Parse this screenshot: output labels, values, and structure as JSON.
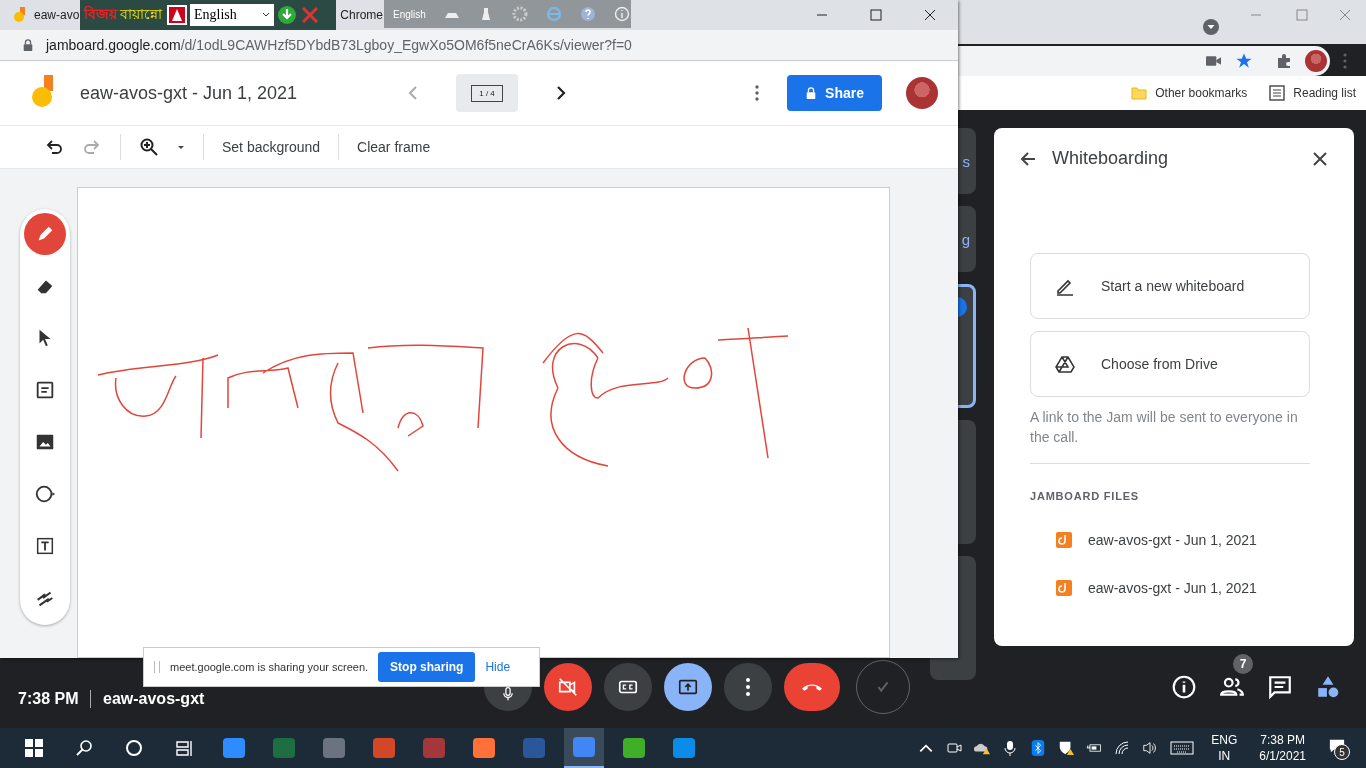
{
  "browser": {
    "bookmarks": [
      {
        "kind": "folder",
        "label": "Other bookmarks"
      },
      {
        "kind": "list",
        "label": "Reading list"
      }
    ]
  },
  "popup": {
    "tab_title": "eaw-avo",
    "tab_title_tail": "Chrome",
    "url_host": "jamboard.google.com",
    "url_path": "/d/1odL9CAWHzf5DYbdB73Lgboy_EgwXo5OM6f5neCrA6Ks/viewer?f=0"
  },
  "keyboard_tool": {
    "logo": "বিজয়",
    "name": "বায়ান্নো",
    "layout": "English",
    "language_bar": "English"
  },
  "jamboard": {
    "title": "eaw-avos-gxt - Jun 1, 2021",
    "frame_counter": "1 / 4",
    "share": "Share",
    "toolbar": [
      "Set background",
      "Clear frame"
    ],
    "tools": [
      {
        "kind": "pen",
        "selected": true
      },
      {
        "kind": "eraser",
        "selected": false
      },
      {
        "kind": "select",
        "selected": false
      },
      {
        "kind": "note",
        "selected": false
      },
      {
        "kind": "image",
        "selected": false
      },
      {
        "kind": "circle",
        "selected": false
      },
      {
        "kind": "textbox",
        "selected": false
      },
      {
        "kind": "laser",
        "selected": false
      }
    ]
  },
  "meet_tiles": [
    {
      "label": "s",
      "selected": false
    },
    {
      "label": "g",
      "selected": false
    },
    {
      "selected": true
    },
    {
      "selected": false
    },
    {
      "selected": false
    }
  ],
  "panel": {
    "title": "Whiteboarding",
    "actions": [
      {
        "kind": "new",
        "label": "Start a new whiteboard"
      },
      {
        "kind": "drive",
        "label": "Choose from Drive"
      }
    ],
    "note": "A link to the Jam will be sent to everyone in the call.",
    "files_heading": "JAMBOARD FILES",
    "files": [
      "eaw-avos-gxt - Jun 1, 2021",
      "eaw-avos-gxt - Jun 1, 2021"
    ]
  },
  "share_notice": {
    "message": "meet.google.com is sharing your screen.",
    "stop": "Stop sharing",
    "hide": "Hide"
  },
  "meeting_bar": {
    "time": "7:38 PM",
    "meeting_name": "eaw-avos-gxt",
    "people_count": "7",
    "controls": [
      {
        "kind": "mic"
      },
      {
        "kind": "camera-off"
      },
      {
        "kind": "captions"
      },
      {
        "kind": "present"
      },
      {
        "kind": "more"
      },
      {
        "kind": "leave"
      },
      {
        "kind": "check"
      }
    ]
  },
  "taskbar": {
    "apps": [
      {
        "kind": "zoom",
        "selected": false
      },
      {
        "kind": "excel",
        "selected": false
      },
      {
        "kind": "camera",
        "selected": false
      },
      {
        "kind": "powerpoint",
        "selected": false
      },
      {
        "kind": "access",
        "selected": false
      },
      {
        "kind": "firefox",
        "selected": false
      },
      {
        "kind": "word",
        "selected": false
      },
      {
        "kind": "chrome",
        "selected": true
      },
      {
        "kind": "camtasia",
        "selected": false
      },
      {
        "kind": "edge",
        "selected": false
      }
    ],
    "language": "ENG",
    "region": "IN",
    "time": "7:38 PM",
    "date": "6/1/2021",
    "notifications": "5"
  }
}
